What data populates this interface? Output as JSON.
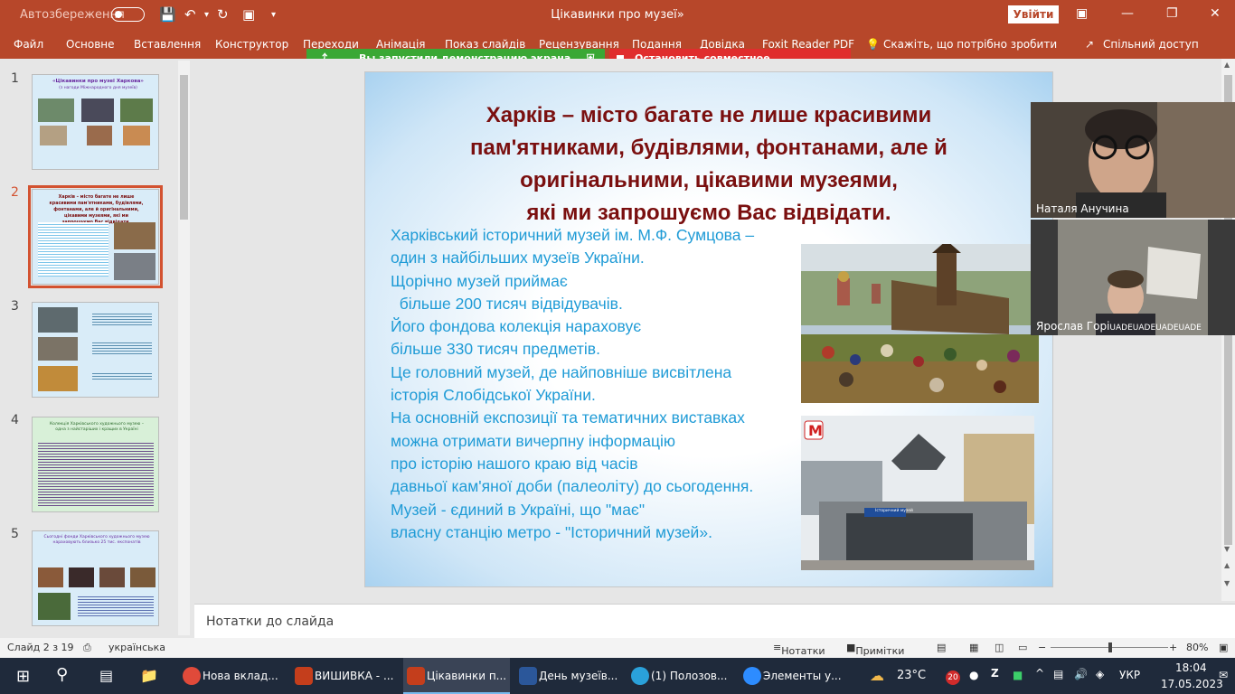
{
  "titlebar": {
    "autosave": "Автозбереження",
    "doc_title": "Цікавинки про музеї»",
    "signin": "Увійти"
  },
  "ribbon": {
    "tabs": [
      "Файл",
      "Основне",
      "Вставлення",
      "Конструктор",
      "Переходи",
      "Анімація",
      "Показ слайдів",
      "Рецензування",
      "Подання",
      "Довідка",
      "Foxit Reader PDF"
    ],
    "tell_me": "Скажіть, що потрібно зробити",
    "share": "Спільний доступ"
  },
  "screen_share": {
    "status": "Вы запустили демонстрацию экрана",
    "stop": "Остановить совместное использование"
  },
  "thumbnails": {
    "numbers": [
      "1",
      "2",
      "3",
      "4",
      "5"
    ],
    "t1_title": "«Цікавинки про музеї Харкова»",
    "t1_sub": "(з нагоди Міжнародного дня музеїв)",
    "t2_title": "Харків – місто багате не лише красивими пам'ятниками, будівлями, фонтанами, але й оригінальними, цікавими музеями, які ми запрошуємо Вас відвідати.",
    "t4_title": "Колекція Харківського художнього музею – одна з найстаріших і кращих в Україні",
    "t5_title": "Сьогодні фонди Харківського художнього музею нараховують близько 25 тис. експонатів"
  },
  "slide": {
    "title": [
      "Харків – місто багате не лише красивими",
      "пам'ятниками, будівлями, фонтанами, але й",
      "оригінальними, цікавими музеями,",
      "які ми запрошуємо Вас відвідати."
    ],
    "body": [
      "Харківський історичний музей ім. М.Ф. Сумцова –",
      "один з найбільших музеїв України.",
      "Щорічно музей приймає",
      "  більше 200 тисяч відвідувачів.",
      "Його фондова колекція нараховує",
      "більше 330 тисяч предметів.",
      "Це головний музей, де найповніше висвітлена",
      "історія Слобідської України.",
      "На основній експозиції та тематичних виставках",
      "можна отримати вичерпну інформацію",
      "про історію нашого краю від часів",
      "давньої кам'яної доби (палеоліту) до сьогодення.",
      "Музей - єдиний в Україні, що \"має\"",
      "власну станцію метро - \"Історичний музей»."
    ],
    "metro_sign": "Історичний музей"
  },
  "video": {
    "p1": "Наталя Анучина",
    "p2": "Ярослав Горі",
    "p2_suffix": "UADEUADEUADEUADE"
  },
  "notes": {
    "placeholder": "Нотатки до слайда"
  },
  "statusbar": {
    "slide": "Слайд 2 з 19",
    "lang": "українська",
    "notes": "Нотатки",
    "comments": "Примітки",
    "zoom": "80%"
  },
  "taskbar": {
    "apps": [
      "Нова вклад...",
      "ВИШИВКА - ...",
      "Цікавинки п...",
      "День музеїв...",
      "(1) Полозов...",
      "Элементы у..."
    ],
    "temp": "23°C",
    "lang": "УКР",
    "time": "18:04",
    "date": "17.05.2023",
    "badge": "20"
  },
  "colors": {
    "accent": "#b7472a",
    "title_text": "#7a0f0f",
    "body_text": "#1f9bd6"
  }
}
